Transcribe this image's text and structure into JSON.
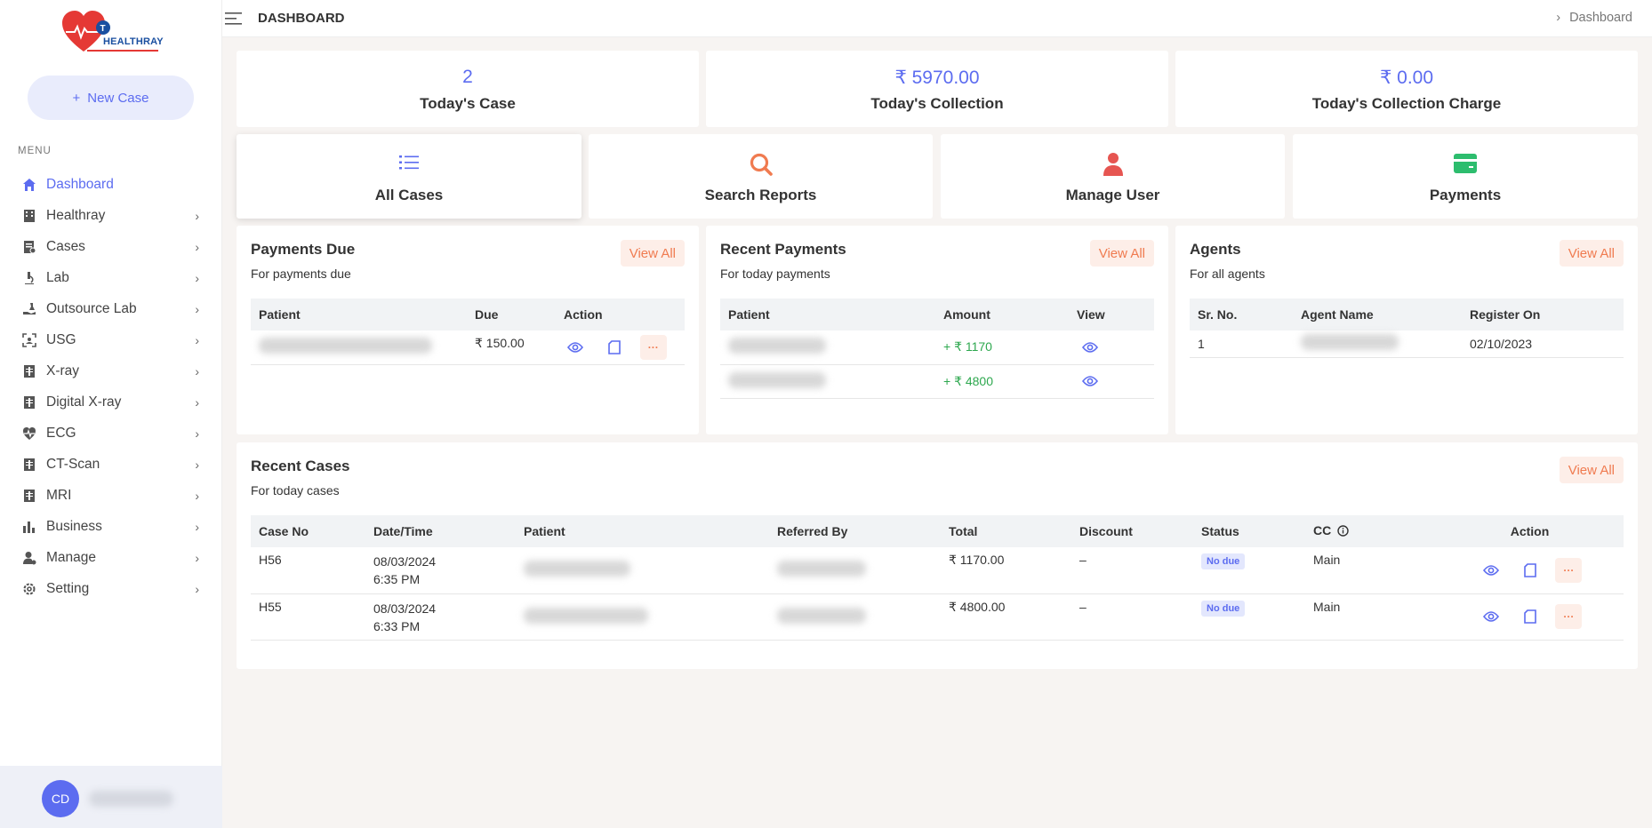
{
  "brand": {
    "name": "HEALTHRAY"
  },
  "sidebar": {
    "new_case_label": "New Case",
    "menu_label": "MENU",
    "items": [
      {
        "label": "Dashboard",
        "icon": "home-icon"
      },
      {
        "label": "Healthray",
        "icon": "building-icon"
      },
      {
        "label": "Cases",
        "icon": "case-file-icon"
      },
      {
        "label": "Lab",
        "icon": "microscope-icon"
      },
      {
        "label": "Outsource Lab",
        "icon": "hand-flask-icon"
      },
      {
        "label": "USG",
        "icon": "scan-icon"
      },
      {
        "label": "X-ray",
        "icon": "xray-icon"
      },
      {
        "label": "Digital X-ray",
        "icon": "digital-xray-icon"
      },
      {
        "label": "ECG",
        "icon": "heartbeat-icon"
      },
      {
        "label": "CT-Scan",
        "icon": "ct-scan-icon"
      },
      {
        "label": "MRI",
        "icon": "mri-icon"
      },
      {
        "label": "Business",
        "icon": "bar-chart-icon"
      },
      {
        "label": "Manage",
        "icon": "user-gear-icon"
      },
      {
        "label": "Setting",
        "icon": "gear-icon"
      }
    ],
    "user_initials": "CD"
  },
  "topbar": {
    "title": "DASHBOARD",
    "breadcrumb": "Dashboard"
  },
  "stats": [
    {
      "value": "2",
      "label": "Today's Case"
    },
    {
      "value": "₹ 5970.00",
      "label": "Today's Collection"
    },
    {
      "value": "₹ 0.00",
      "label": "Today's Collection Charge"
    }
  ],
  "quick_links": [
    {
      "label": "All Cases",
      "icon": "list-icon"
    },
    {
      "label": "Search Reports",
      "icon": "search-icon"
    },
    {
      "label": "Manage User",
      "icon": "user-icon"
    },
    {
      "label": "Payments",
      "icon": "wallet-icon"
    }
  ],
  "payments_due": {
    "title": "Payments Due",
    "subtitle": "For payments due",
    "view_all": "View All",
    "columns": [
      "Patient",
      "Due",
      "Action"
    ],
    "rows": [
      {
        "due": "₹ 150.00"
      }
    ]
  },
  "recent_payments": {
    "title": "Recent Payments",
    "subtitle": "For today payments",
    "view_all": "View All",
    "columns": [
      "Patient",
      "Amount",
      "View"
    ],
    "rows": [
      {
        "amount": "+ ₹ 1170"
      },
      {
        "amount": "+ ₹ 4800"
      }
    ]
  },
  "agents": {
    "title": "Agents",
    "subtitle": "For all agents",
    "view_all": "View All",
    "columns": [
      "Sr. No.",
      "Agent Name",
      "Register On"
    ],
    "rows": [
      {
        "sr": "1",
        "registered": "02/10/2023"
      }
    ]
  },
  "recent_cases": {
    "title": "Recent Cases",
    "subtitle": "For today cases",
    "view_all": "View All",
    "columns": [
      "Case No",
      "Date/Time",
      "Patient",
      "Referred By",
      "Total",
      "Discount",
      "Status",
      "CC",
      "Action"
    ],
    "rows": [
      {
        "case_no": "H56",
        "date": "08/03/2024",
        "time": "6:35 PM",
        "total": "₹ 1170.00",
        "discount": "–",
        "status": "No due",
        "cc": "Main"
      },
      {
        "case_no": "H55",
        "date": "08/03/2024",
        "time": "6:33 PM",
        "total": "₹ 4800.00",
        "discount": "–",
        "status": "No due",
        "cc": "Main"
      }
    ]
  },
  "colors": {
    "accent": "#5c6cf0",
    "orange": "#f07b50",
    "green": "#2ea84f",
    "logo_red": "#e53935"
  }
}
